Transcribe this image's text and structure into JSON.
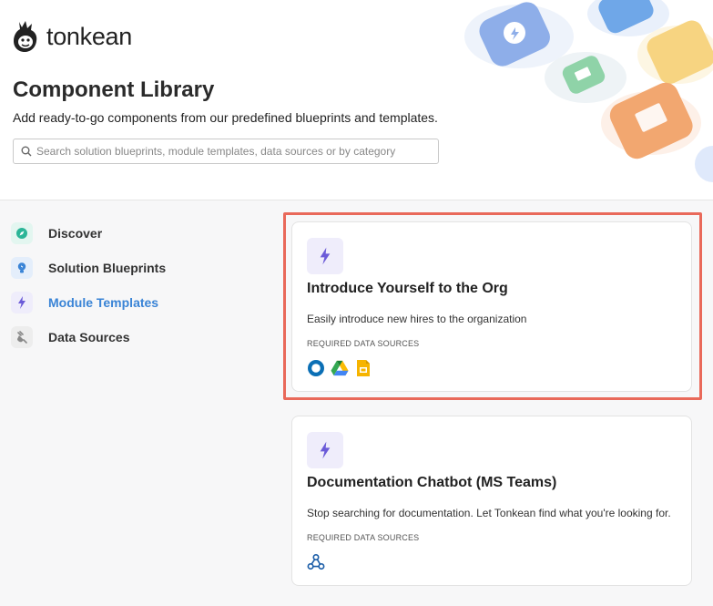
{
  "brand": {
    "name": "tonkean",
    "logo_icon": "monkey-logo-icon"
  },
  "header": {
    "title": "Component Library",
    "subtitle": "Add ready-to-go components from our predefined blueprints and templates."
  },
  "search": {
    "placeholder": "Search solution blueprints, module templates, data sources or by category",
    "value": "",
    "icon": "search-icon"
  },
  "sidebar": {
    "items": [
      {
        "label": "Discover",
        "icon": "compass-icon",
        "active": false,
        "color": "#2bb597"
      },
      {
        "label": "Solution Blueprints",
        "icon": "lightbulb-icon",
        "active": false,
        "color": "#3a84d6"
      },
      {
        "label": "Module Templates",
        "icon": "lightning-icon",
        "active": true,
        "color": "#6b5bd8"
      },
      {
        "label": "Data Sources",
        "icon": "plug-icon",
        "active": false,
        "color": "#888888"
      }
    ]
  },
  "cards": [
    {
      "title": "Introduce Yourself to the Org",
      "description": "Easily introduce new hires to the organization",
      "required_label": "REQUIRED DATA SOURCES",
      "icon": "lightning-icon",
      "sources": [
        "okta-icon",
        "google-drive-icon",
        "google-slides-icon"
      ]
    },
    {
      "title": "Documentation Chatbot (MS Teams)",
      "description": "Stop searching for documentation. Let Tonkean find what you're looking for.",
      "required_label": "REQUIRED DATA SOURCES",
      "icon": "lightning-icon",
      "sources": [
        "webhook-icon"
      ]
    }
  ],
  "colors": {
    "accent": "#3a84d6",
    "module_tile": "#efedfb",
    "lightning": "#6b5bd8",
    "highlight_border": "#e9695a"
  }
}
